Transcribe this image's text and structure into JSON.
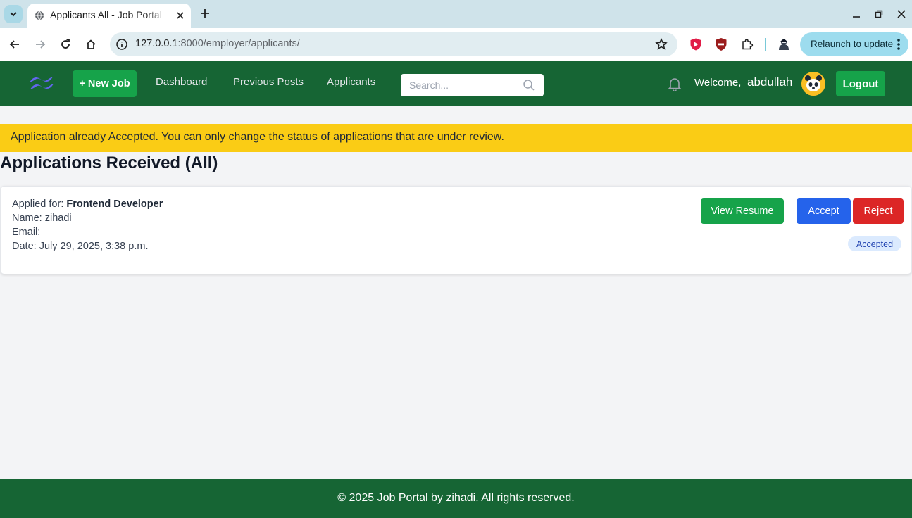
{
  "browser": {
    "tab_title": "Applicants All - Job Portal",
    "url_host": "127.0.0.1",
    "url_path": ":8000/employer/applicants/",
    "relaunch_label": "Relaunch to update"
  },
  "navbar": {
    "new_job_label": "+ New Job",
    "links": [
      "Dashboard",
      "Previous Posts",
      "Applicants"
    ],
    "search_placeholder": "Search...",
    "welcome_label": "Welcome,",
    "username": "abdullah",
    "logout_label": "Logout"
  },
  "alert": {
    "message": "Application already Accepted. You can only change the status of applications that are under review."
  },
  "page": {
    "heading": "Applications Received (All)"
  },
  "applications": [
    {
      "applied_for_label": "Applied for:",
      "job_title": "Frontend Developer",
      "name_label": "Name:",
      "name": "zihadi",
      "email_label": "Email:",
      "email": "",
      "date_label": "Date:",
      "date": "July 29, 2025, 3:38 p.m.",
      "view_resume_label": "View Resume",
      "accept_label": "Accept",
      "reject_label": "Reject",
      "status": "Accepted"
    }
  ],
  "footer": {
    "text": "© 2025 Job Portal by zihadi. All rights reserved."
  },
  "colors": {
    "navbar_bg": "#166534",
    "primary_green": "#16a34a",
    "accept_blue": "#2563eb",
    "reject_red": "#dc2626",
    "alert_yellow": "#facc15",
    "badge_bg": "#dbeafe"
  },
  "icons": [
    "chevron-down-icon",
    "globe-icon",
    "close-icon",
    "plus-icon",
    "minimize-icon",
    "restore-icon",
    "back-arrow-icon",
    "forward-arrow-icon",
    "reload-icon",
    "home-icon",
    "info-icon",
    "star-icon",
    "extension-icon",
    "puzzle-icon",
    "profile-icon",
    "more-vert-icon",
    "tailwind-logo-icon",
    "search-icon",
    "bell-icon",
    "panda-avatar-icon"
  ]
}
